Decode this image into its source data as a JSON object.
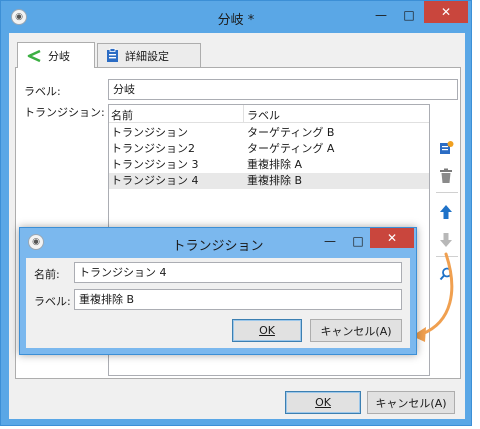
{
  "main": {
    "title": "分岐 *",
    "controls": {
      "minimize": "—",
      "maximize": "□",
      "close": "✕"
    },
    "tabs": [
      {
        "label": "分岐",
        "icon": "branch-icon"
      },
      {
        "label": "詳細設定",
        "icon": "clipboard-icon"
      }
    ],
    "label_field": {
      "label": "ラベル:",
      "value": "分岐"
    },
    "transitions": {
      "label": "トランジション:",
      "columns": [
        "名前",
        "ラベル"
      ],
      "rows": [
        {
          "name": "トランジション",
          "label": "ターゲティング B"
        },
        {
          "name": "トランジション2",
          "label": "ターゲティング A"
        },
        {
          "name": "トランジション 3",
          "label": "重複排除 A"
        },
        {
          "name": "トランジション 4",
          "label": "重複排除 B"
        }
      ]
    },
    "toolbar_icons": [
      "add-icon",
      "delete-icon",
      "move-up-icon",
      "move-down-icon",
      "search-icon"
    ],
    "buttons": {
      "ok": "OK",
      "cancel": "キャンセル(A)"
    }
  },
  "dialog": {
    "title": "トランジション",
    "controls": {
      "minimize": "—",
      "maximize": "□",
      "close": "✕"
    },
    "name_field": {
      "label": "名前:",
      "value": "トランジション 4"
    },
    "label_field": {
      "label": "ラベル:",
      "value": "重複排除 B"
    },
    "buttons": {
      "ok": "OK",
      "cancel": "キャンセル(A)"
    }
  },
  "colors": {
    "accent": "#5aa7e6",
    "close": "#c9463d",
    "arrow": "#f0a050",
    "selected_row": "#e8e8e8"
  }
}
